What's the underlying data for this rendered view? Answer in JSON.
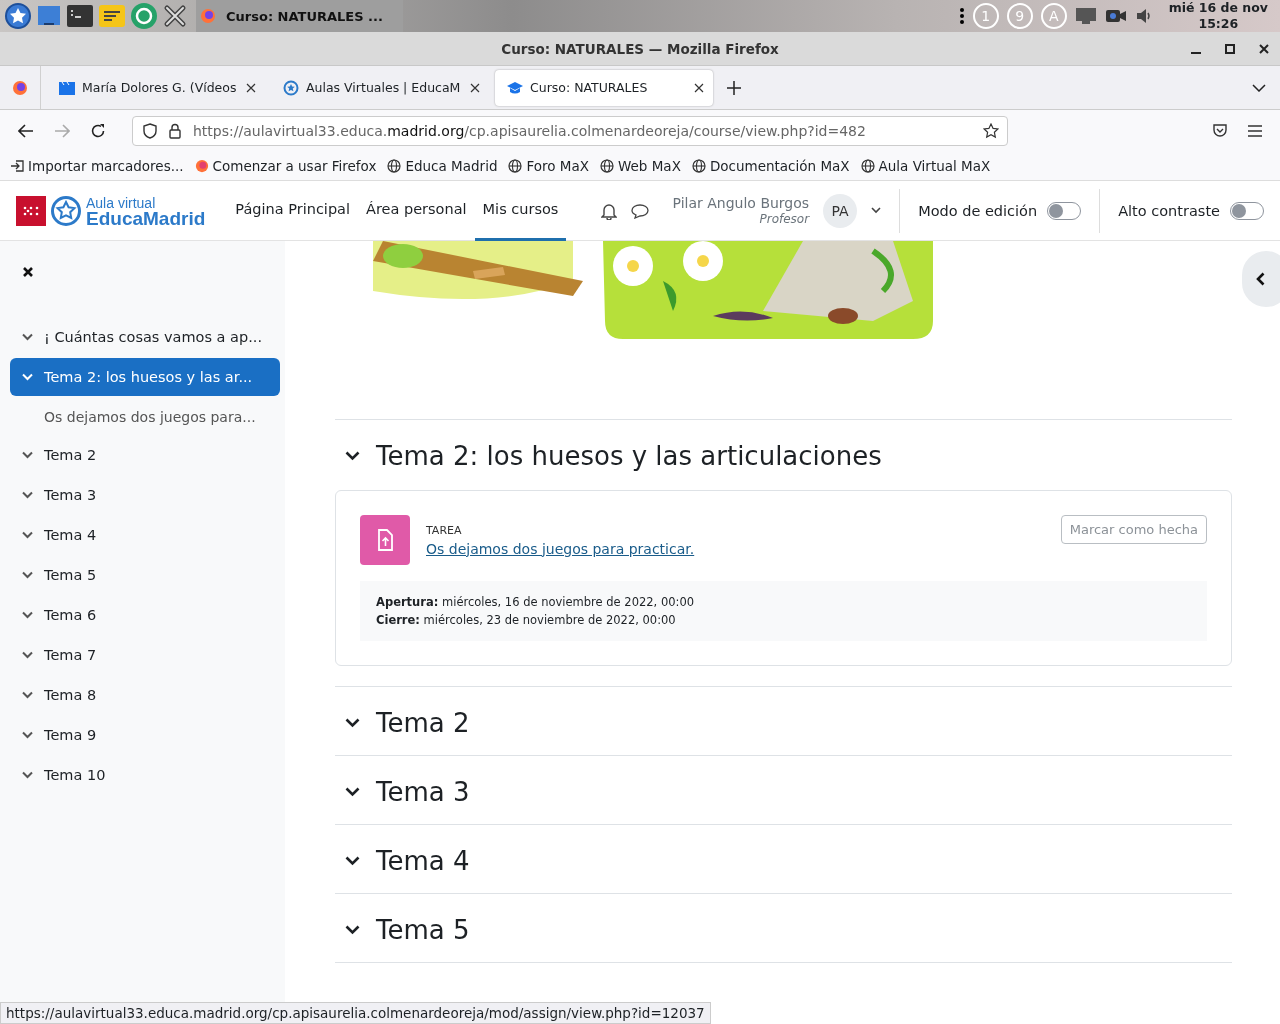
{
  "desktop_panel": {
    "window_button": "Curso: NATURALES ...",
    "tray_badges": [
      "1",
      "9",
      "A"
    ],
    "clock_date": "mié 16 de nov",
    "clock_time": "15:26"
  },
  "window": {
    "title": "Curso: NATURALES — Mozilla Firefox"
  },
  "tabs": [
    {
      "label": "María Dolores G. (Vídeos",
      "kind": "clapper",
      "selected": false
    },
    {
      "label": "Aulas Virtuales | EducaM",
      "kind": "star",
      "selected": false
    },
    {
      "label": "Curso: NATURALES",
      "kind": "cap",
      "selected": true
    }
  ],
  "address_bar": {
    "url_prefix": "https://aulavirtual33.educa.",
    "url_domain": "madrid.org",
    "url_path": "/cp.apisaurelia.colmenardeoreja/course/view.php?id=482"
  },
  "bookmarks": [
    {
      "label": "Importar marcadores...",
      "kind": "import"
    },
    {
      "label": "Comenzar a usar Firefox",
      "kind": "firefox"
    },
    {
      "label": "Educa Madrid",
      "kind": "globe"
    },
    {
      "label": "Foro MaX",
      "kind": "globe"
    },
    {
      "label": "Web MaX",
      "kind": "globe"
    },
    {
      "label": "Documentación MaX",
      "kind": "globe"
    },
    {
      "label": "Aula Virtual MaX",
      "kind": "globe"
    }
  ],
  "site_header": {
    "logo_small": "Aula virtual",
    "logo_big": "EducaMadrid",
    "nav": [
      {
        "label": "Página Principal",
        "selected": false
      },
      {
        "label": "Área personal",
        "selected": false
      },
      {
        "label": "Mis cursos",
        "selected": true
      }
    ],
    "user": {
      "name": "Pilar Angulo Burgos",
      "role": "Profesor",
      "initials": "PA"
    },
    "toggles": [
      {
        "label": "Modo de edición",
        "on": false
      },
      {
        "label": "Alto contraste",
        "on": false
      }
    ]
  },
  "sidebar": {
    "items": [
      {
        "label": "¡ Cuántas cosas vamos a ap...",
        "expanded": true,
        "selected": false
      },
      {
        "label": "Tema 2: los huesos y las ar...",
        "expanded": true,
        "selected": true,
        "children": [
          {
            "label": "Os dejamos dos juegos para..."
          }
        ]
      },
      {
        "label": "Tema 2",
        "expanded": true,
        "selected": false
      },
      {
        "label": "Tema 3",
        "expanded": true,
        "selected": false
      },
      {
        "label": "Tema 4",
        "expanded": true,
        "selected": false
      },
      {
        "label": "Tema 5",
        "expanded": true,
        "selected": false
      },
      {
        "label": "Tema 6",
        "expanded": true,
        "selected": false
      },
      {
        "label": "Tema 7",
        "expanded": true,
        "selected": false
      },
      {
        "label": "Tema 8",
        "expanded": true,
        "selected": false
      },
      {
        "label": "Tema 9",
        "expanded": true,
        "selected": false
      },
      {
        "label": "Tema 10",
        "expanded": true,
        "selected": false
      }
    ]
  },
  "sections": [
    {
      "title": "Tema 2: los huesos y las articulaciones",
      "expanded": true,
      "activities": [
        {
          "type_label": "TAREA",
          "title": "Os dejamos dos juegos para practicar.",
          "button": "Marcar como hecha",
          "dates": [
            "**Apertura:** miércoles, 16 de noviembre de 2022, 00:00",
            "**Cierre:** miércoles, 23 de noviembre de 2022, 00:00"
          ]
        }
      ]
    },
    {
      "title": "Tema 2",
      "expanded": true
    },
    {
      "title": "Tema 3",
      "expanded": true
    },
    {
      "title": "Tema 4",
      "expanded": true
    },
    {
      "title": "Tema 5",
      "expanded": true
    }
  ],
  "status_url": "https://aulavirtual33.educa.madrid.org/cp.apisaurelia.colmenardeoreja/mod/assign/view.php?id=12037"
}
